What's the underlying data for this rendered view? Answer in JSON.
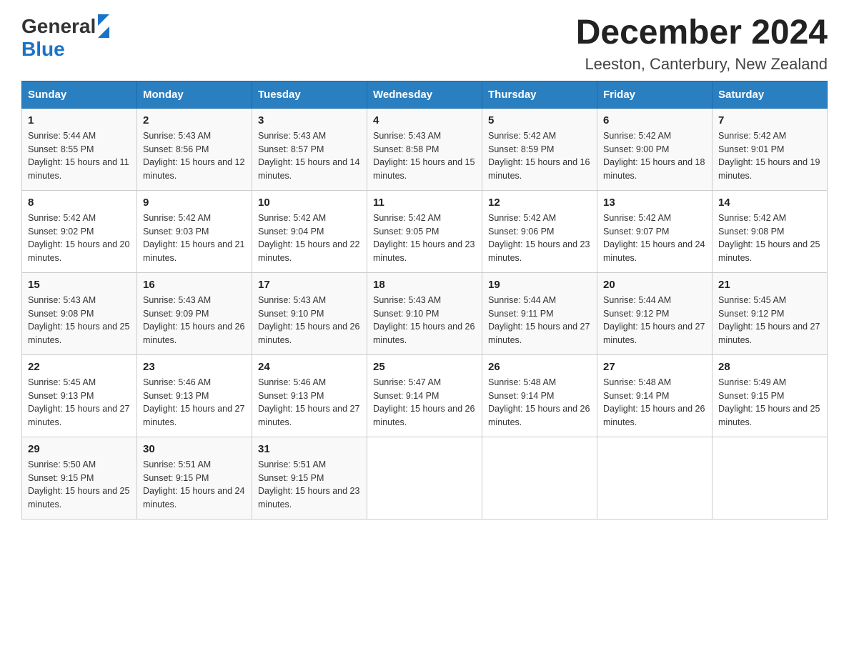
{
  "header": {
    "logo": {
      "general": "General",
      "blue": "Blue"
    },
    "title": "December 2024",
    "location": "Leeston, Canterbury, New Zealand"
  },
  "weekdays": [
    "Sunday",
    "Monday",
    "Tuesday",
    "Wednesday",
    "Thursday",
    "Friday",
    "Saturday"
  ],
  "weeks": [
    [
      {
        "day": "1",
        "sunrise": "5:44 AM",
        "sunset": "8:55 PM",
        "daylight": "15 hours and 11 minutes."
      },
      {
        "day": "2",
        "sunrise": "5:43 AM",
        "sunset": "8:56 PM",
        "daylight": "15 hours and 12 minutes."
      },
      {
        "day": "3",
        "sunrise": "5:43 AM",
        "sunset": "8:57 PM",
        "daylight": "15 hours and 14 minutes."
      },
      {
        "day": "4",
        "sunrise": "5:43 AM",
        "sunset": "8:58 PM",
        "daylight": "15 hours and 15 minutes."
      },
      {
        "day": "5",
        "sunrise": "5:42 AM",
        "sunset": "8:59 PM",
        "daylight": "15 hours and 16 minutes."
      },
      {
        "day": "6",
        "sunrise": "5:42 AM",
        "sunset": "9:00 PM",
        "daylight": "15 hours and 18 minutes."
      },
      {
        "day": "7",
        "sunrise": "5:42 AM",
        "sunset": "9:01 PM",
        "daylight": "15 hours and 19 minutes."
      }
    ],
    [
      {
        "day": "8",
        "sunrise": "5:42 AM",
        "sunset": "9:02 PM",
        "daylight": "15 hours and 20 minutes."
      },
      {
        "day": "9",
        "sunrise": "5:42 AM",
        "sunset": "9:03 PM",
        "daylight": "15 hours and 21 minutes."
      },
      {
        "day": "10",
        "sunrise": "5:42 AM",
        "sunset": "9:04 PM",
        "daylight": "15 hours and 22 minutes."
      },
      {
        "day": "11",
        "sunrise": "5:42 AM",
        "sunset": "9:05 PM",
        "daylight": "15 hours and 23 minutes."
      },
      {
        "day": "12",
        "sunrise": "5:42 AM",
        "sunset": "9:06 PM",
        "daylight": "15 hours and 23 minutes."
      },
      {
        "day": "13",
        "sunrise": "5:42 AM",
        "sunset": "9:07 PM",
        "daylight": "15 hours and 24 minutes."
      },
      {
        "day": "14",
        "sunrise": "5:42 AM",
        "sunset": "9:08 PM",
        "daylight": "15 hours and 25 minutes."
      }
    ],
    [
      {
        "day": "15",
        "sunrise": "5:43 AM",
        "sunset": "9:08 PM",
        "daylight": "15 hours and 25 minutes."
      },
      {
        "day": "16",
        "sunrise": "5:43 AM",
        "sunset": "9:09 PM",
        "daylight": "15 hours and 26 minutes."
      },
      {
        "day": "17",
        "sunrise": "5:43 AM",
        "sunset": "9:10 PM",
        "daylight": "15 hours and 26 minutes."
      },
      {
        "day": "18",
        "sunrise": "5:43 AM",
        "sunset": "9:10 PM",
        "daylight": "15 hours and 26 minutes."
      },
      {
        "day": "19",
        "sunrise": "5:44 AM",
        "sunset": "9:11 PM",
        "daylight": "15 hours and 27 minutes."
      },
      {
        "day": "20",
        "sunrise": "5:44 AM",
        "sunset": "9:12 PM",
        "daylight": "15 hours and 27 minutes."
      },
      {
        "day": "21",
        "sunrise": "5:45 AM",
        "sunset": "9:12 PM",
        "daylight": "15 hours and 27 minutes."
      }
    ],
    [
      {
        "day": "22",
        "sunrise": "5:45 AM",
        "sunset": "9:13 PM",
        "daylight": "15 hours and 27 minutes."
      },
      {
        "day": "23",
        "sunrise": "5:46 AM",
        "sunset": "9:13 PM",
        "daylight": "15 hours and 27 minutes."
      },
      {
        "day": "24",
        "sunrise": "5:46 AM",
        "sunset": "9:13 PM",
        "daylight": "15 hours and 27 minutes."
      },
      {
        "day": "25",
        "sunrise": "5:47 AM",
        "sunset": "9:14 PM",
        "daylight": "15 hours and 26 minutes."
      },
      {
        "day": "26",
        "sunrise": "5:48 AM",
        "sunset": "9:14 PM",
        "daylight": "15 hours and 26 minutes."
      },
      {
        "day": "27",
        "sunrise": "5:48 AM",
        "sunset": "9:14 PM",
        "daylight": "15 hours and 26 minutes."
      },
      {
        "day": "28",
        "sunrise": "5:49 AM",
        "sunset": "9:15 PM",
        "daylight": "15 hours and 25 minutes."
      }
    ],
    [
      {
        "day": "29",
        "sunrise": "5:50 AM",
        "sunset": "9:15 PM",
        "daylight": "15 hours and 25 minutes."
      },
      {
        "day": "30",
        "sunrise": "5:51 AM",
        "sunset": "9:15 PM",
        "daylight": "15 hours and 24 minutes."
      },
      {
        "day": "31",
        "sunrise": "5:51 AM",
        "sunset": "9:15 PM",
        "daylight": "15 hours and 23 minutes."
      },
      null,
      null,
      null,
      null
    ]
  ]
}
